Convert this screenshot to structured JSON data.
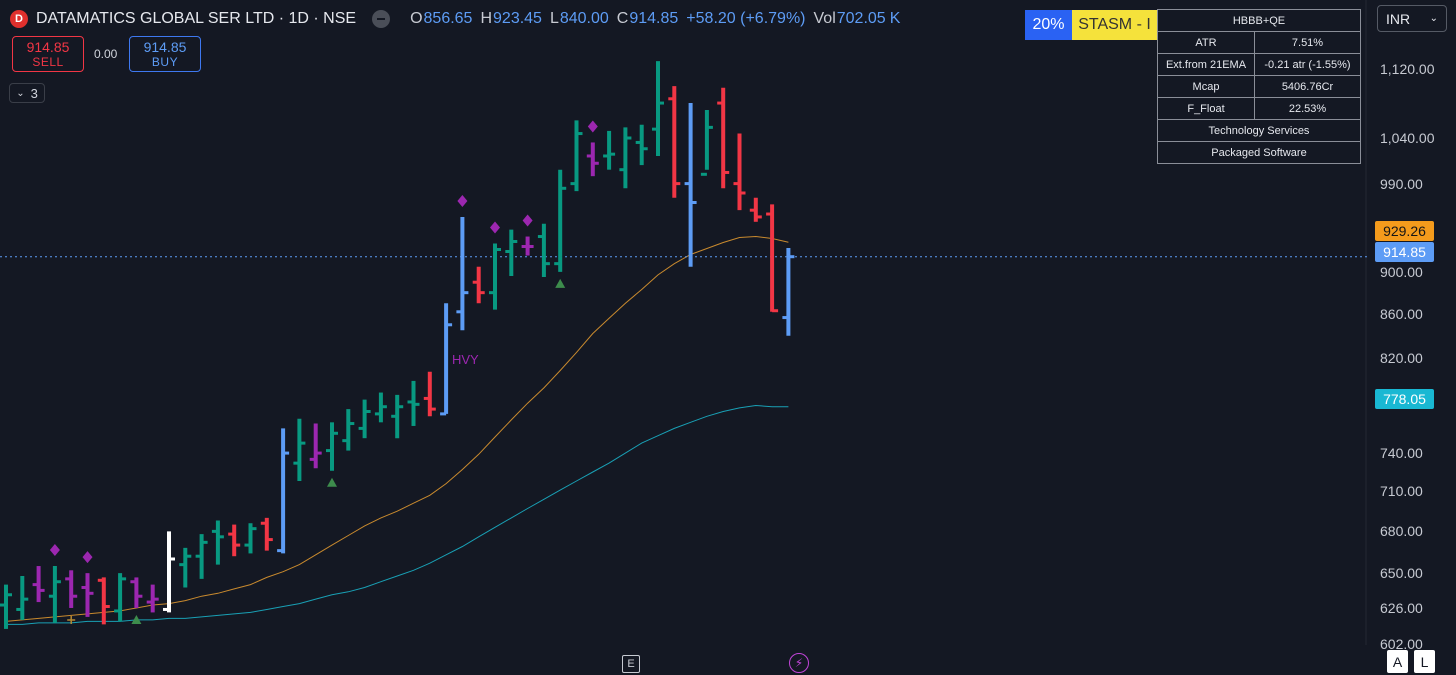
{
  "header": {
    "badge_letter": "D",
    "symbol": "DATAMATICS GLOBAL SER LTD · 1D · NSE",
    "open_label": "O",
    "open": "856.65",
    "high_label": "H",
    "high": "923.45",
    "low_label": "L",
    "low": "840.00",
    "close_label": "C",
    "close": "914.85",
    "change": "+58.20 (+6.79%)",
    "vol_label": "Vol",
    "vol": "702.05",
    "vol_unit": "K"
  },
  "trade": {
    "sell_price": "914.85",
    "sell_label": "SELL",
    "spread": "0.00",
    "buy_price": "914.85",
    "buy_label": "BUY",
    "indicators_count": "3"
  },
  "badges": {
    "pct": "20%",
    "stage": "STASM - I"
  },
  "info_table": {
    "title": "HBBB+QE",
    "rows": [
      {
        "k": "ATR",
        "v": "7.51%"
      },
      {
        "k": "Ext.from 21EMA",
        "v": "-0.21 atr (-1.55%)"
      },
      {
        "k": "Mcap",
        "v": "5406.76Cr"
      },
      {
        "k": "F_Float",
        "v": "22.53%"
      }
    ],
    "sector": "Technology Services",
    "industry": "Packaged Software"
  },
  "currency": "INR",
  "price_tags": {
    "ema": "929.26",
    "last": "914.85",
    "sma": "778.05"
  },
  "bottom": {
    "earnings": "E",
    "auto": "A",
    "log": "L"
  },
  "colors": {
    "up": "#089981",
    "down": "#f23645",
    "pocket": "#5d9cf5",
    "inside": "#9c27b0",
    "ema21": "#c98a2e",
    "sma50": "#19a0b5",
    "marker": "#9c27b0"
  },
  "chart_data": {
    "type": "ohlc-bar",
    "scale": "log",
    "ylim": [
      595,
      1175
    ],
    "y_ticks": [
      602,
      626,
      650,
      680,
      710,
      740,
      820,
      860,
      900,
      990,
      1040,
      1120
    ],
    "y_tick_labels": [
      "602.00",
      "626.00",
      "650.00",
      "680.00",
      "710.00",
      "740.00",
      "820.00",
      "860.00",
      "900.00",
      "990.00",
      "1,040.00",
      "1,120.00"
    ],
    "last_price": 914.85,
    "bars": [
      {
        "o": 628,
        "h": 642,
        "l": 612,
        "c": 635,
        "t": "up"
      },
      {
        "o": 625,
        "h": 648,
        "l": 618,
        "c": 632,
        "t": "up"
      },
      {
        "o": 642,
        "h": 655,
        "l": 630,
        "c": 638,
        "t": "inside"
      },
      {
        "o": 634,
        "h": 655,
        "l": 616,
        "c": 644,
        "t": "up"
      },
      {
        "o": 646,
        "h": 652,
        "l": 626,
        "c": 634,
        "t": "inside"
      },
      {
        "o": 640,
        "h": 650,
        "l": 620,
        "c": 636,
        "t": "inside"
      },
      {
        "o": 645,
        "h": 647,
        "l": 615,
        "c": 627,
        "t": "down"
      },
      {
        "o": 624,
        "h": 650,
        "l": 617,
        "c": 646,
        "t": "up"
      },
      {
        "o": 644,
        "h": 647,
        "l": 626,
        "c": 634,
        "t": "inside"
      },
      {
        "o": 630,
        "h": 642,
        "l": 623,
        "c": 632,
        "t": "inside"
      },
      {
        "o": 625,
        "h": 680,
        "l": 623,
        "c": 660,
        "t": "breakout"
      },
      {
        "o": 656,
        "h": 668,
        "l": 640,
        "c": 662,
        "t": "up"
      },
      {
        "o": 662,
        "h": 678,
        "l": 646,
        "c": 672,
        "t": "up"
      },
      {
        "o": 680,
        "h": 688,
        "l": 656,
        "c": 676,
        "t": "up"
      },
      {
        "o": 678,
        "h": 685,
        "l": 662,
        "c": 670,
        "t": "down"
      },
      {
        "o": 670,
        "h": 686,
        "l": 664,
        "c": 682,
        "t": "up"
      },
      {
        "o": 686,
        "h": 690,
        "l": 666,
        "c": 674,
        "t": "down"
      },
      {
        "o": 666,
        "h": 760,
        "l": 664,
        "c": 740,
        "t": "pocket"
      },
      {
        "o": 732,
        "h": 768,
        "l": 718,
        "c": 748,
        "t": "up"
      },
      {
        "o": 735,
        "h": 764,
        "l": 728,
        "c": 740,
        "t": "inside"
      },
      {
        "o": 742,
        "h": 765,
        "l": 726,
        "c": 756,
        "t": "up"
      },
      {
        "o": 750,
        "h": 776,
        "l": 742,
        "c": 764,
        "t": "up"
      },
      {
        "o": 760,
        "h": 784,
        "l": 752,
        "c": 774,
        "t": "up"
      },
      {
        "o": 772,
        "h": 790,
        "l": 765,
        "c": 778,
        "t": "up"
      },
      {
        "o": 770,
        "h": 788,
        "l": 752,
        "c": 778,
        "t": "up"
      },
      {
        "o": 782,
        "h": 800,
        "l": 762,
        "c": 780,
        "t": "up"
      },
      {
        "o": 785,
        "h": 808,
        "l": 770,
        "c": 776,
        "t": "down"
      },
      {
        "o": 772,
        "h": 870,
        "l": 772,
        "c": 850,
        "t": "pocket"
      },
      {
        "o": 862,
        "h": 955,
        "l": 845,
        "c": 880,
        "t": "pocket"
      },
      {
        "o": 890,
        "h": 905,
        "l": 870,
        "c": 880,
        "t": "down"
      },
      {
        "o": 880,
        "h": 928,
        "l": 864,
        "c": 922,
        "t": "up"
      },
      {
        "o": 920,
        "h": 942,
        "l": 896,
        "c": 930,
        "t": "up"
      },
      {
        "o": 925,
        "h": 935,
        "l": 916,
        "c": 925,
        "t": "inside"
      },
      {
        "o": 935,
        "h": 948,
        "l": 895,
        "c": 908,
        "t": "up"
      },
      {
        "o": 908,
        "h": 1005,
        "l": 900,
        "c": 985,
        "t": "up"
      },
      {
        "o": 990,
        "h": 1060,
        "l": 982,
        "c": 1045,
        "t": "up"
      },
      {
        "o": 1020,
        "h": 1035,
        "l": 998,
        "c": 1012,
        "t": "inside"
      },
      {
        "o": 1020,
        "h": 1048,
        "l": 1005,
        "c": 1022,
        "t": "up"
      },
      {
        "o": 1005,
        "h": 1052,
        "l": 985,
        "c": 1040,
        "t": "up"
      },
      {
        "o": 1035,
        "h": 1055,
        "l": 1010,
        "c": 1028,
        "t": "up"
      },
      {
        "o": 1050,
        "h": 1130,
        "l": 1020,
        "c": 1080,
        "t": "up"
      },
      {
        "o": 1085,
        "h": 1100,
        "l": 975,
        "c": 990,
        "t": "down"
      },
      {
        "o": 990,
        "h": 1080,
        "l": 905,
        "c": 970,
        "t": "pocket"
      },
      {
        "o": 1000,
        "h": 1072,
        "l": 1005,
        "c": 1052,
        "t": "up"
      },
      {
        "o": 1080,
        "h": 1098,
        "l": 985,
        "c": 1002,
        "t": "down"
      },
      {
        "o": 990,
        "h": 1045,
        "l": 962,
        "c": 980,
        "t": "down"
      },
      {
        "o": 962,
        "h": 975,
        "l": 950,
        "c": 955,
        "t": "down"
      },
      {
        "o": 958,
        "h": 968,
        "l": 862,
        "c": 863,
        "t": "down"
      },
      {
        "o": 856.65,
        "h": 923.45,
        "l": 840,
        "c": 914.85,
        "t": "pocket"
      }
    ],
    "ema21": [
      617,
      618,
      619,
      620,
      621,
      622,
      623,
      624,
      626,
      628,
      629,
      631,
      634,
      636,
      639,
      642,
      647,
      651,
      656,
      663,
      670,
      677,
      684,
      690,
      695,
      701,
      707,
      716,
      727,
      739,
      753,
      767,
      781,
      794,
      809,
      825,
      842,
      856,
      870,
      883,
      897,
      908,
      917,
      923,
      929,
      934,
      935,
      933,
      929.26
    ],
    "sma50": [
      615,
      615,
      616,
      616,
      616,
      617,
      617,
      617,
      618,
      618,
      619,
      619,
      620,
      621,
      622,
      623,
      625,
      627,
      629,
      632,
      635,
      637,
      640,
      644,
      648,
      652,
      657,
      663,
      669,
      676,
      683,
      690,
      697,
      704,
      711,
      718,
      725,
      732,
      740,
      748,
      754,
      760,
      765,
      770,
      774,
      777,
      779,
      778,
      778.05
    ],
    "diamonds": [
      3,
      5,
      28,
      30,
      32,
      36
    ],
    "triangles": [
      8,
      20,
      34
    ],
    "plus_marks": [
      4
    ],
    "annotations": [
      {
        "bar": 21,
        "text": "HVY"
      }
    ]
  }
}
